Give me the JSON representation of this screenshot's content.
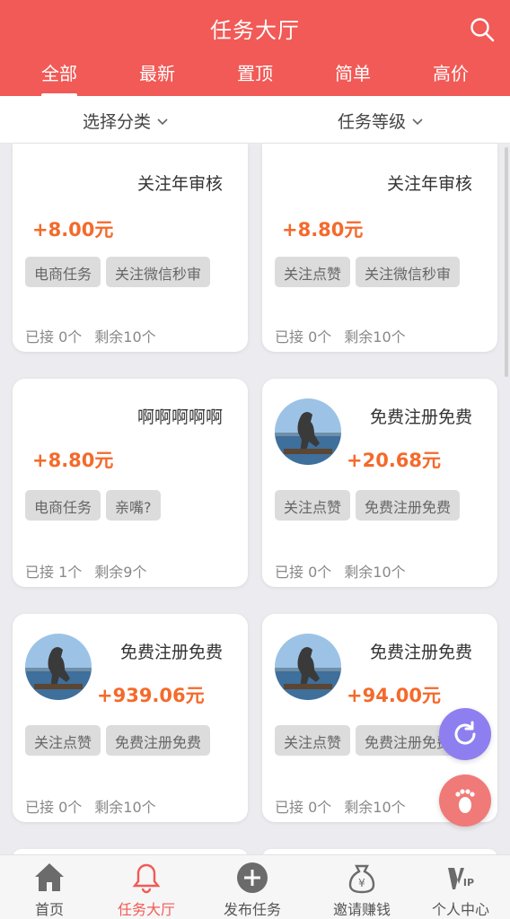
{
  "header": {
    "title": "任务大厅",
    "accent_color": "#f15a56",
    "search_icon": "search-icon"
  },
  "tabs": [
    {
      "label": "全部",
      "active": true
    },
    {
      "label": "最新",
      "active": false
    },
    {
      "label": "置顶",
      "active": false
    },
    {
      "label": "简单",
      "active": false
    },
    {
      "label": "高价",
      "active": false
    }
  ],
  "filters": {
    "category": "选择分类",
    "level": "任务等级"
  },
  "cards": [
    {
      "name": "关注年审核",
      "price": "+8.00元",
      "tags": [
        "电商任务",
        "关注微信秒审"
      ],
      "accepted": "已接 0个",
      "remaining": "剩余10个",
      "has_avatar": false
    },
    {
      "name": "关注年审核",
      "price": "+8.80元",
      "tags": [
        "关注点赞",
        "关注微信秒审"
      ],
      "accepted": "已接 0个",
      "remaining": "剩余10个",
      "has_avatar": false
    },
    {
      "name": "啊啊啊啊啊",
      "price": "+8.80元",
      "tags": [
        "电商任务",
        "亲嘴?"
      ],
      "accepted": "已接 1个",
      "remaining": "剩余9个",
      "has_avatar": false
    },
    {
      "name": "免费注册免费",
      "price": "+20.68元",
      "tags": [
        "关注点赞",
        "免费注册免费"
      ],
      "accepted": "已接 0个",
      "remaining": "剩余10个",
      "has_avatar": true
    },
    {
      "name": "免费注册免费",
      "price": "+939.06元",
      "tags": [
        "关注点赞",
        "免费注册免费"
      ],
      "accepted": "已接 0个",
      "remaining": "剩余10个",
      "has_avatar": true
    },
    {
      "name": "免费注册免费",
      "price": "+94.00元",
      "tags": [
        "关注点赞",
        "免费注册免费"
      ],
      "accepted": "已接 0个",
      "remaining": "剩余10个",
      "has_avatar": true
    }
  ],
  "price_color": "#f46a2b",
  "fabs": {
    "refresh_color": "#8e7ff0",
    "footprint_color": "#f07a77"
  },
  "bottom_nav": [
    {
      "label": "首页",
      "icon": "home-icon",
      "active": false
    },
    {
      "label": "任务大厅",
      "icon": "bell-icon",
      "active": true
    },
    {
      "label": "发布任务",
      "icon": "plus-circle-icon",
      "active": false
    },
    {
      "label": "邀请赚钱",
      "icon": "money-bag-icon",
      "active": false
    },
    {
      "label": "个人中心",
      "icon": "vip-icon",
      "active": false
    }
  ]
}
